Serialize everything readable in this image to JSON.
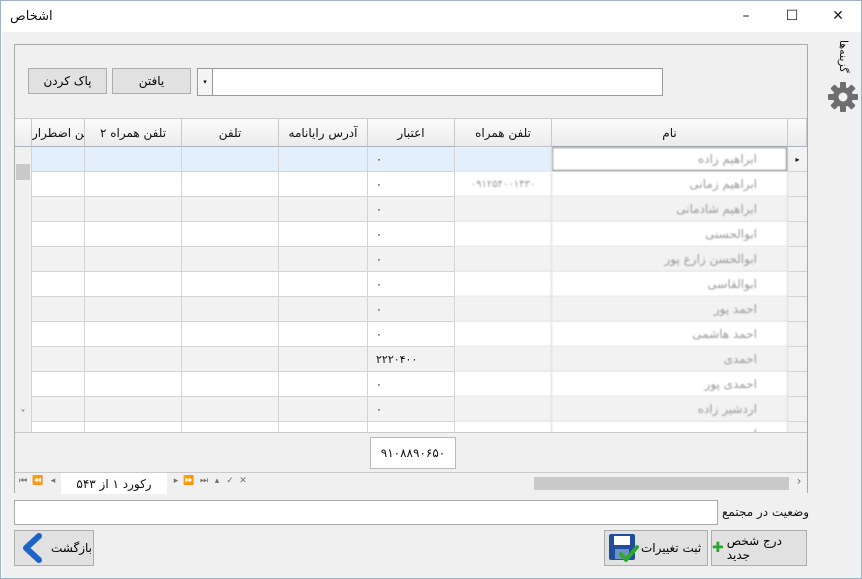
{
  "window": {
    "title": "اشخاص",
    "minimize_glyph": "–",
    "maximize_glyph": "☐",
    "close_glyph": "✕"
  },
  "search": {
    "find_label": "یافتن",
    "clear_label": "پاک کردن",
    "value": "",
    "dropdown_glyph": "▾"
  },
  "side": {
    "options_label": "گزینه‌ها",
    "icon": "gear-icon"
  },
  "grid": {
    "columns": [
      "نام",
      "تلفن همراه",
      "اعتبار",
      "آدرس رایانامه",
      "تلفن",
      "تلفن همراه ۲",
      "تلفن اضطرار"
    ],
    "rows": [
      {
        "name": "ابراهیم زاده",
        "mobile": "",
        "credit": "۰"
      },
      {
        "name": "ابراهیم زمانی",
        "mobile": "۰۹۱۲۵۴۰۰۱۴۳۰",
        "credit": "۰"
      },
      {
        "name": "ابراهیم شادمانی",
        "mobile": "",
        "credit": "۰"
      },
      {
        "name": "ابوالحسنی",
        "mobile": "",
        "credit": "۰"
      },
      {
        "name": "ابوالحسن زارع پور",
        "mobile": "",
        "credit": "۰"
      },
      {
        "name": "ابوالقاسی",
        "mobile": "",
        "credit": "۰"
      },
      {
        "name": "احمد پور",
        "mobile": "",
        "credit": "۰"
      },
      {
        "name": "احمد هاشمی",
        "mobile": "",
        "credit": "۰"
      },
      {
        "name": "احمدی",
        "mobile": "",
        "credit": "۲۲۲۰۴۰۰"
      },
      {
        "name": "احمدی پور",
        "mobile": "",
        "credit": "۰"
      },
      {
        "name": "اردشیر زاده",
        "mobile": "",
        "credit": "۰"
      },
      {
        "name": "اسدی",
        "mobile": "",
        "credit": ""
      }
    ],
    "current_row_marker": "▸",
    "scroll_down_glyph": "˅",
    "total": "۹۱۰۸۸۹۰۶۵۰"
  },
  "navigator": {
    "record_label": "رکورد ۱ از ۵۴۳",
    "first": "⏮",
    "prev_page": "⏪",
    "prev": "◂",
    "next": "▸",
    "next_page": "⏩",
    "last": "⏭",
    "insert": "▴",
    "post": "✓",
    "cancel": "✕",
    "scroll_left": "‹",
    "scroll_right": "›"
  },
  "status": {
    "label": "وضعیت در مجتمع",
    "value": ""
  },
  "actions": {
    "back_label": "بازگشت",
    "save_label": "ثبت تغییرات",
    "new_label": "درج شخص جدید"
  },
  "colors": {
    "accent_blue": "#1e64c8",
    "save_green": "#2ea82e",
    "add_green": "#2aa32a",
    "gear_gray": "#6e6e6e"
  }
}
